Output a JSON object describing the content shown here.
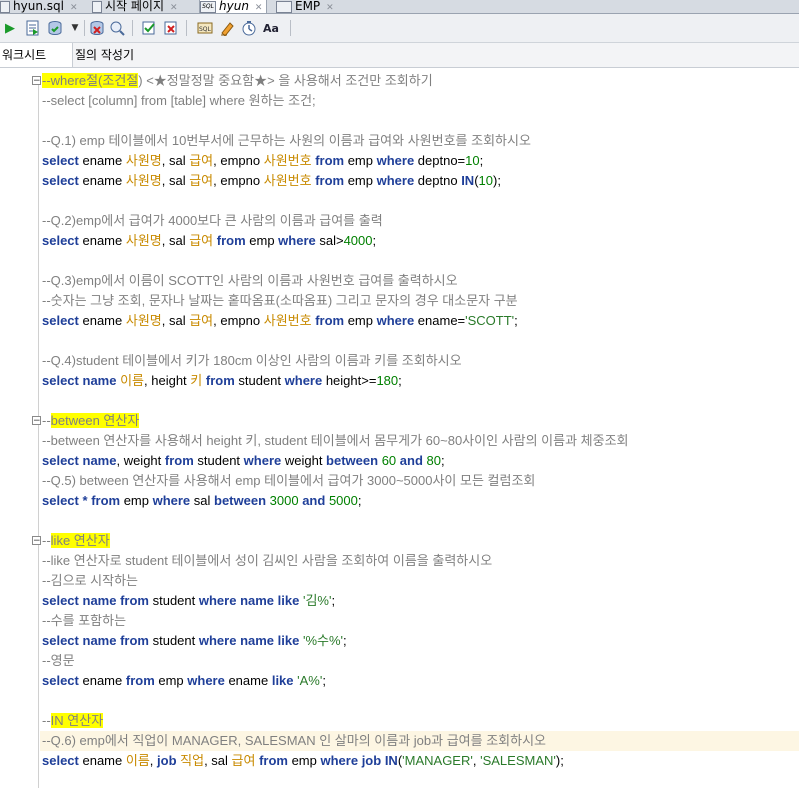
{
  "tabs": [
    {
      "label": "hyun.sql"
    },
    {
      "label": "시작 페이지"
    },
    {
      "label": "hyun"
    },
    {
      "label": "EMP"
    }
  ],
  "subtabs": [
    {
      "label": "워크시트"
    },
    {
      "label": "질의 작성기"
    }
  ],
  "toolbar_icons": [
    "run-statement-icon",
    "run-script-icon",
    "commit-icon",
    "rollback-icon",
    "cancel-icon",
    "sql-tuning-icon",
    "autotrace-icon",
    "sql-history-icon",
    "clear-icon",
    "explain-plan-icon",
    "format-icon"
  ],
  "colors": {
    "keyword": "#1f3f99",
    "alias": "#c88a00",
    "number": "#008000",
    "string": "#2a7a2a",
    "comment": "#808080",
    "highlight": "#ffff00"
  },
  "code": {
    "where_title_a": "--",
    "where_title_b": "where절(조건절",
    "where_title_c": ") <★정말정말 중요함★> 을 사용해서 조건만 조회하기",
    "where_sub": "--select [column] from [table] where 원하는 조건;",
    "q1": "--Q.1) emp 테이블에서 10번부서에 근무하는 사원의 이름과 급여와 사원번호를 조회하시오",
    "q2": "--Q.2)emp에서 급여가 4000보다 큰 사람의 이름과 급여를 출력",
    "q3": "--Q.3)emp에서 이름이 SCOTT인 사람의 이름과 사원번호 급여를 출력하시오",
    "q3b": "--숫자는 그냥 조회, 문자나 날짜는 홑따옴표(소따옴표) 그리고 문자의 경우 대소문자 구분",
    "q4": "--Q.4)student 테이블에서 키가 180cm 이상인 사람의 이름과 키를 조회하시오",
    "between_a": "--",
    "between_b": "between 연산자",
    "between_desc": "--between 연산자를 사용해서 height 키, student 테이블에서 몸무게가 60~80사이인 사람의 이름과 체중조회",
    "q5": "--Q.5) between 연산자를 사용해서 emp 테이블에서 급여가 3000~5000사이 모든 컬럼조회",
    "like_a": "--",
    "like_b": "like 연산자",
    "like_desc": "--like 연산자로 student 테이블에서 성이 김씨인 사람을 조회하여 이름을 출력하시오",
    "like_kim": "--김으로 시작하는",
    "like_su": "--수를 포함하는",
    "like_eng": "--영문",
    "in_a": "--",
    "in_b": "IN 연산자",
    "q6": "--Q.6) emp에서 직업이 MANAGER, SALESMAN 인 살마의 이름과 job과 급여를 조회하시오",
    "t_select": "select",
    "t_from": "from",
    "t_where": "where",
    "t_in": "IN",
    "t_between": "between",
    "t_and": "and",
    "t_like": "like",
    "t_name": "name",
    "t_job": "job",
    "t_star": "*",
    "w_ename": " ename ",
    "w_sal": ", sal ",
    "w_empno": ", empno ",
    "w_emp": " emp ",
    "w_deptno_eq": " deptno=",
    "w_deptno": " deptno ",
    "w_sal_gt": " sal>",
    "w_ename_eq": " ename=",
    "w_height": ", height ",
    "w_student": " student ",
    "w_height_ge": " height>=",
    "w_weight": ", weight ",
    "w_weight2": " weight ",
    "w_sal2": " sal ",
    "w_sp": " ",
    "w_comma": ", ",
    "w_lp": "(",
    "w_rp": ")",
    "w_semi": ";",
    "w_rp_semi": ");",
    "a_sawonmyeong": "사원명",
    "a_geubyeo": "급여",
    "a_sawonbeonho": "사원번호",
    "a_ireum": "이름",
    "a_ki": "키",
    "a_jigeop": "직업",
    "n_10": "10",
    "n_4000": "4000",
    "n_180": "180",
    "n_60": "60",
    "n_80": "80",
    "n_3000": "3000",
    "n_5000": "5000",
    "s_scott": "'SCOTT'",
    "s_kim": "'김%'",
    "s_su": "'%수%'",
    "s_a": "'A%'",
    "s_manager": "'MANAGER'",
    "s_salesman": "'SALESMAN'"
  }
}
